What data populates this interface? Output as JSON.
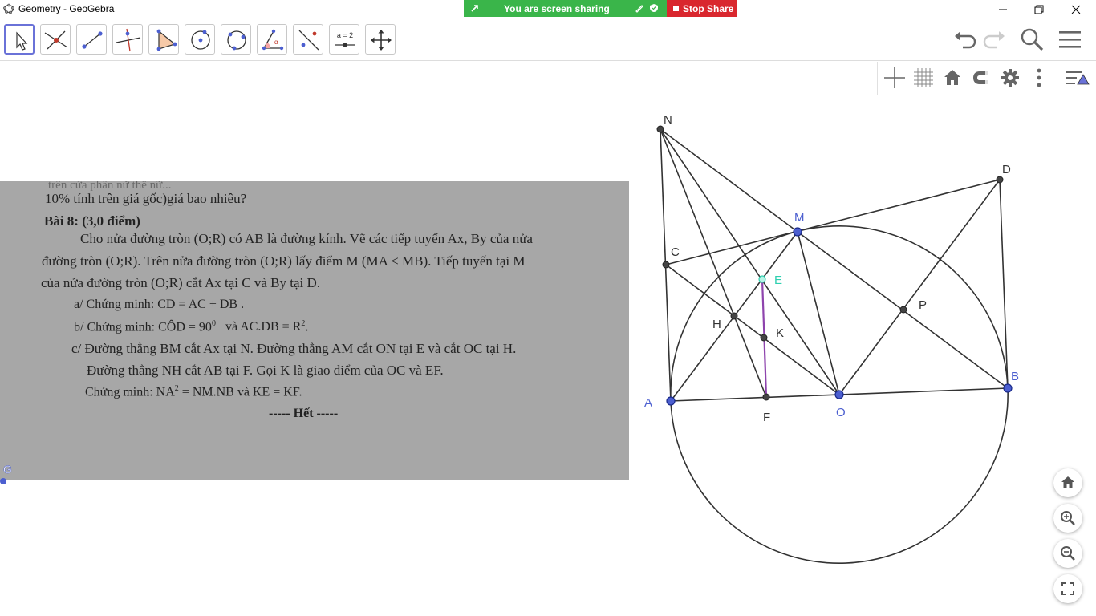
{
  "window": {
    "title": "Geometry - GeoGebra"
  },
  "share": {
    "text": "You are screen sharing",
    "stop_label": "Stop Share"
  },
  "toolbar": {
    "tools": [
      "move-tool",
      "point-intersect-tool",
      "segment-tool",
      "perpendicular-line-tool",
      "polygon-tool",
      "circle-center-point-tool",
      "circle-three-points-tool",
      "angle-tool",
      "reflect-tool",
      "slider-tool",
      "move-graphics-view-tool"
    ],
    "slider_label": "a = 2"
  },
  "photo": {
    "lines": [
      "10% tính trên giá gốc)giá bao nhiêu?",
      "Bài 8: (3,0 điểm)",
      "Cho nửa đường tròn (O;R) có AB là đường kính. Vẽ các tiếp tuyến Ax, By của nửa",
      "đường tròn (O;R). Trên nửa đường tròn (O;R) lấy điểm M (MA < MB). Tiếp tuyến tại M",
      "của nửa đường tròn (O;R) cắt Ax tại C và By tại D.",
      "a/ Chứng minh: CD = AC + DB .",
      "b/ Chứng minh: CÔD = 90",
      "và AC.DB = R",
      "c/ Đường thẳng BM cắt Ax tại N. Đường thẳng AM cắt ON tại E và cắt OC tại H.",
      "Đường thẳng NH cắt AB tại F. Gọi K là giao điểm của OC và EF.",
      "Chứng minh: NA",
      "= NM.NB và KE = KF.",
      "----- Hết -----"
    ],
    "sup_0": "0",
    "sup_2": "2"
  },
  "graphics": {
    "points": {
      "N": "N",
      "D": "D",
      "M": "M",
      "C": "C",
      "E": "E",
      "P": "P",
      "H": "H",
      "K": "K",
      "A": "A",
      "F": "F",
      "O": "O",
      "B": "B",
      "G": "G"
    },
    "colors": {
      "free_point": "#4c5fd0",
      "dependent_point": "#444444",
      "segment": "#333333",
      "segment_EF": "#8e44ad",
      "label_E": "#2ed0b0"
    }
  }
}
